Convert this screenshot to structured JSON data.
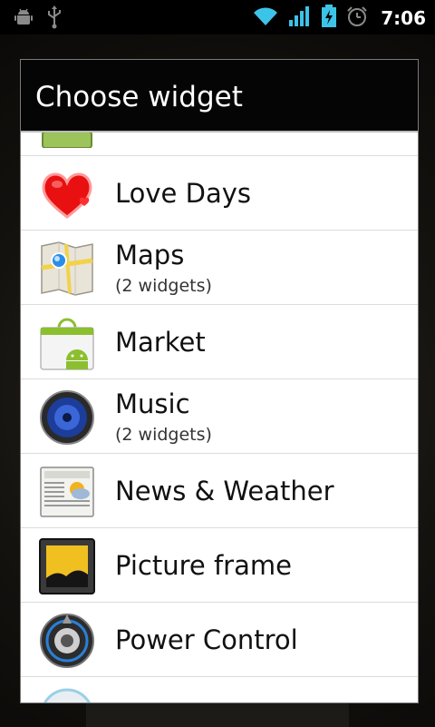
{
  "status_bar": {
    "time": "7:06",
    "left_icons": [
      "android-debug-icon",
      "usb-icon"
    ],
    "right_icons": [
      "wifi-icon",
      "signal-icon",
      "battery-charging-icon",
      "alarm-icon"
    ]
  },
  "dialog": {
    "title": "Choose widget",
    "items": [
      {
        "label": "",
        "sub": "",
        "icon": "partial-widget-icon"
      },
      {
        "label": "Love Days",
        "sub": "",
        "icon": "heart-icon"
      },
      {
        "label": "Maps",
        "sub": "(2 widgets)",
        "icon": "maps-icon"
      },
      {
        "label": "Market",
        "sub": "",
        "icon": "market-icon"
      },
      {
        "label": "Music",
        "sub": "(2 widgets)",
        "icon": "music-speaker-icon"
      },
      {
        "label": "News & Weather",
        "sub": "",
        "icon": "news-weather-icon"
      },
      {
        "label": "Picture frame",
        "sub": "",
        "icon": "picture-frame-icon"
      },
      {
        "label": "Power Control",
        "sub": "",
        "icon": "power-control-icon"
      },
      {
        "label": "",
        "sub": "",
        "icon": "partial-widget-icon-bottom"
      }
    ]
  },
  "colors": {
    "title_bar": "#050505",
    "list_background": "#ffffff",
    "divider": "#dcdcdc",
    "status_accent": "#3cc3e8"
  }
}
